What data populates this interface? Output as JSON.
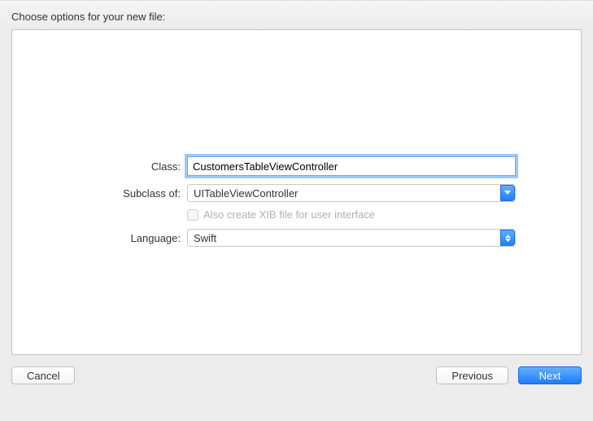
{
  "header": {
    "title": "Choose options for your new file:"
  },
  "form": {
    "class_label": "Class:",
    "class_value": "CustomersTableViewController",
    "subclass_label": "Subclass of:",
    "subclass_value": "UITableViewController",
    "xib_label": "Also create XIB file for user interface",
    "language_label": "Language:",
    "language_value": "Swift"
  },
  "footer": {
    "cancel": "Cancel",
    "previous": "Previous",
    "next": "Next"
  }
}
